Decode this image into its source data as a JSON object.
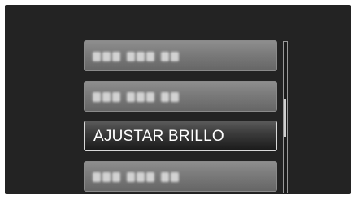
{
  "menu": {
    "items": [
      {
        "label": "",
        "state": "disabled"
      },
      {
        "label": "",
        "state": "disabled"
      },
      {
        "label": "AJUSTAR BRILLO",
        "state": "selected"
      },
      {
        "label": "",
        "state": "disabled"
      }
    ]
  },
  "scrollbar": {
    "position_fraction": 0.5,
    "visible_fraction": 0.25
  },
  "colors": {
    "background": "#232323",
    "item_disabled": "#7a7a7a",
    "item_selected": "#2a2a2a",
    "text": "#ffffff"
  }
}
